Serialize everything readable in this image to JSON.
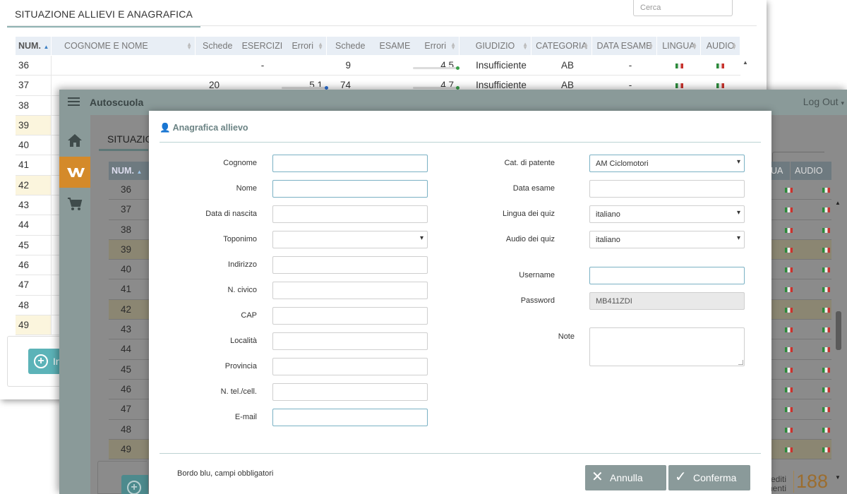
{
  "back_window": {
    "title": "SITUAZIONE ALLIEVI E ANAGRAFICA",
    "search_placeholder": "Cerca",
    "columns": [
      "NUM.",
      "COGNOME E NOME",
      "Schede",
      "ESERCIZI",
      "Errori",
      "Schede",
      "ESAME",
      "Errori",
      "GIUDIZIO",
      "CATEGORIA",
      "DATA ESAME",
      "LINGUA",
      "AUDIO"
    ],
    "rows": [
      {
        "num": "36",
        "name": "",
        "ex_schede": "",
        "ex_errori": "",
        "ex_progress": 0,
        "ex_dash": "-",
        "es_schede": "9",
        "es_errori": "4.5",
        "es_progress": 0.95,
        "giudizio": "Insufficiente",
        "categoria": "AB",
        "data_esame": "-",
        "highlight": false
      },
      {
        "num": "37",
        "name": "",
        "ex_schede": "20",
        "ex_errori": "5.1",
        "ex_progress": 0.9,
        "ex_dash": "",
        "es_schede": "74",
        "es_errori": "4.7",
        "es_progress": 0.95,
        "giudizio": "Insufficiente",
        "categoria": "AB",
        "data_esame": "-",
        "highlight": false
      },
      {
        "num": "38",
        "highlight": false
      },
      {
        "num": "39",
        "highlight": true
      },
      {
        "num": "40",
        "highlight": false
      },
      {
        "num": "41",
        "highlight": false
      },
      {
        "num": "42",
        "highlight": true
      },
      {
        "num": "43",
        "highlight": false
      },
      {
        "num": "44",
        "highlight": false
      },
      {
        "num": "45",
        "highlight": false
      },
      {
        "num": "46",
        "highlight": false
      },
      {
        "num": "47",
        "highlight": false
      },
      {
        "num": "48",
        "highlight": false
      },
      {
        "num": "49",
        "highlight": true
      }
    ],
    "add_button_label": "In"
  },
  "front_window": {
    "app_name": "Autoscuola",
    "logout_label": "Log Out",
    "content_title": "SITUAZIO",
    "head_num": "NUM.",
    "head_lingua": "UA",
    "head_audio": "AUDIO",
    "rows": [
      {
        "num": "36",
        "highlight": false
      },
      {
        "num": "37",
        "highlight": false
      },
      {
        "num": "38",
        "highlight": false
      },
      {
        "num": "39",
        "highlight": true
      },
      {
        "num": "40",
        "highlight": false
      },
      {
        "num": "41",
        "highlight": false
      },
      {
        "num": "42",
        "highlight": true
      },
      {
        "num": "43",
        "highlight": false
      },
      {
        "num": "44",
        "highlight": false
      },
      {
        "num": "45",
        "highlight": false
      },
      {
        "num": "46",
        "highlight": false
      },
      {
        "num": "47",
        "highlight": false
      },
      {
        "num": "48",
        "highlight": false
      },
      {
        "num": "49",
        "highlight": true
      }
    ],
    "credits_text_1": "rediti",
    "credits_text_2": "nenti",
    "credits_value": "188",
    "nav_icons": [
      "home-icon",
      "logo-w-icon",
      "cart-icon"
    ]
  },
  "modal": {
    "title": "Anagrafica allievo",
    "left_fields": [
      {
        "label": "Cognome",
        "value": "",
        "required": true,
        "type": "text"
      },
      {
        "label": "Nome",
        "value": "",
        "required": true,
        "type": "text"
      },
      {
        "label": "Data di nascita",
        "value": "",
        "required": false,
        "type": "text"
      },
      {
        "label": "Toponimo",
        "value": "",
        "required": false,
        "type": "select"
      },
      {
        "label": "Indirizzo",
        "value": "",
        "required": false,
        "type": "text"
      },
      {
        "label": "N. civico",
        "value": "",
        "required": false,
        "type": "text"
      },
      {
        "label": "CAP",
        "value": "",
        "required": false,
        "type": "text"
      },
      {
        "label": "Località",
        "value": "",
        "required": false,
        "type": "text"
      },
      {
        "label": "Provincia",
        "value": "",
        "required": false,
        "type": "text"
      },
      {
        "label": "N. tel./cell.",
        "value": "",
        "required": false,
        "type": "text"
      },
      {
        "label": "E-mail",
        "value": "",
        "required": true,
        "type": "text"
      }
    ],
    "right_fields": {
      "cat_patente": {
        "label": "Cat. di patente",
        "value": "AM Ciclomotori"
      },
      "data_esame": {
        "label": "Data esame",
        "value": ""
      },
      "lingua_quiz": {
        "label": "Lingua dei quiz",
        "value": "italiano"
      },
      "audio_quiz": {
        "label": "Audio dei quiz",
        "value": "italiano"
      },
      "username": {
        "label": "Username",
        "value": ""
      },
      "password": {
        "label": "Password",
        "value": "MB411ZDI"
      },
      "note": {
        "label": "Note",
        "value": ""
      }
    },
    "footnote": "Bordo blu, campi obbligatori",
    "cancel_label": "Annulla",
    "confirm_label": "Conferma"
  },
  "colors": {
    "accent_teal": "#5cb3b8",
    "active_nav": "#d48a2a",
    "required_border": "#7ab1c4",
    "modal_button": "#8a9a9a"
  }
}
